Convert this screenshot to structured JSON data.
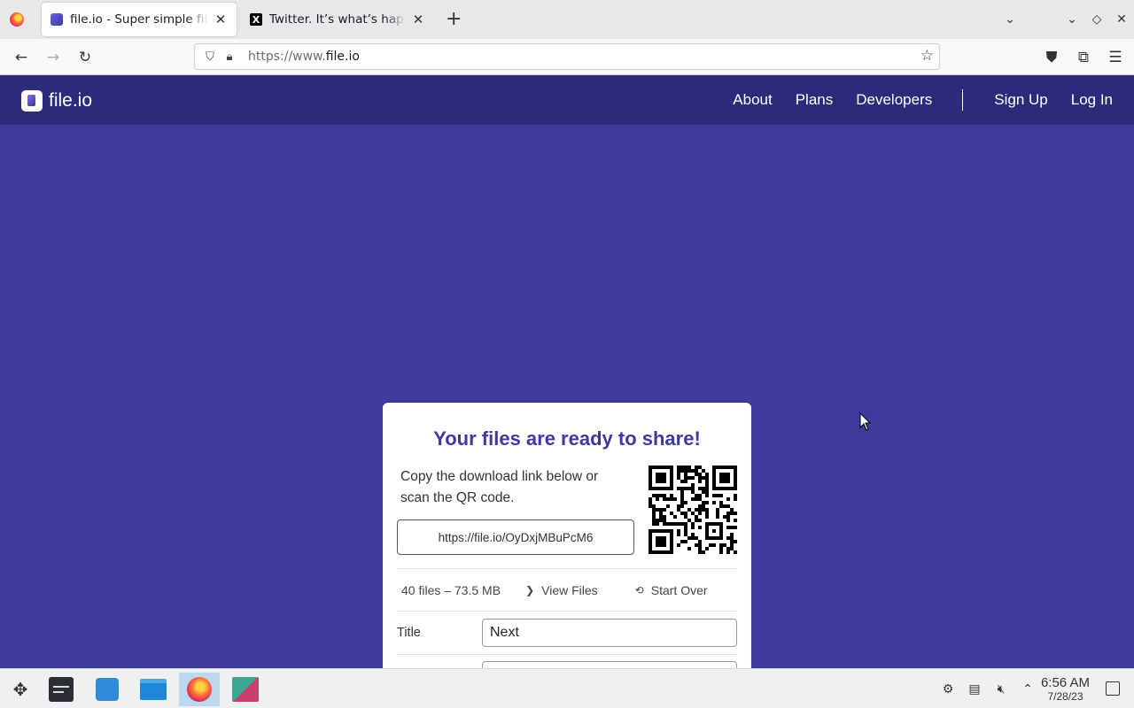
{
  "browser": {
    "tabs": [
      {
        "title": "file.io - Super simple file sharing",
        "active": true
      },
      {
        "title": "Twitter. It’s what’s happening",
        "active": false
      }
    ],
    "url_prefix": "https://www.",
    "url_domain": "file.io"
  },
  "site": {
    "brand": "file.io",
    "nav": [
      "About",
      "Plans",
      "Developers",
      "Sign Up",
      "Log In"
    ]
  },
  "card": {
    "title": "Your files are ready to share!",
    "description": "Copy the download link below or scan the QR code.",
    "link": "https://file.io/OyDxjMBuPcM6",
    "stats": "40 files – 73.5 MB",
    "view_files": "View Files",
    "start_over": "Start Over",
    "title_label": "Title",
    "title_value": "Next"
  },
  "taskbar": {
    "time": "6:56 AM",
    "date": "7/28/23"
  },
  "colors": {
    "page_bg": "#3d3a9c",
    "header_bg": "#2c2a7a",
    "accent": "#3d3a9c"
  }
}
